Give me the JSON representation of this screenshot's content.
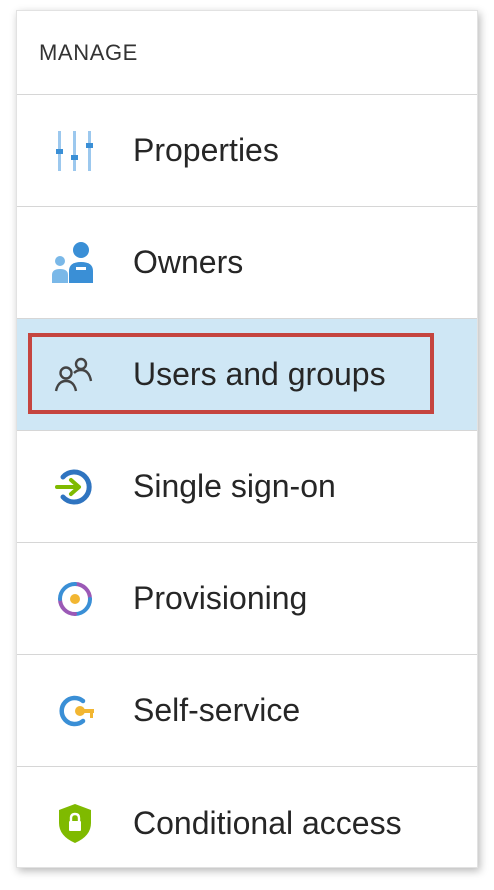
{
  "section": {
    "title": "MANAGE"
  },
  "menu": {
    "items": [
      {
        "label": "Properties",
        "icon": "properties-icon",
        "selected": false
      },
      {
        "label": "Owners",
        "icon": "owners-icon",
        "selected": false
      },
      {
        "label": "Users and groups",
        "icon": "users-groups-icon",
        "selected": true
      },
      {
        "label": "Single sign-on",
        "icon": "single-sign-on-icon",
        "selected": false
      },
      {
        "label": "Provisioning",
        "icon": "provisioning-icon",
        "selected": false
      },
      {
        "label": "Self-service",
        "icon": "self-service-icon",
        "selected": false
      },
      {
        "label": "Conditional access",
        "icon": "conditional-access-icon",
        "selected": false
      }
    ]
  },
  "colors": {
    "selected_background": "#cfe7f5",
    "highlight_border": "#c5453f",
    "icon_blue": "#3a8fd6",
    "icon_green": "#7fba00"
  }
}
